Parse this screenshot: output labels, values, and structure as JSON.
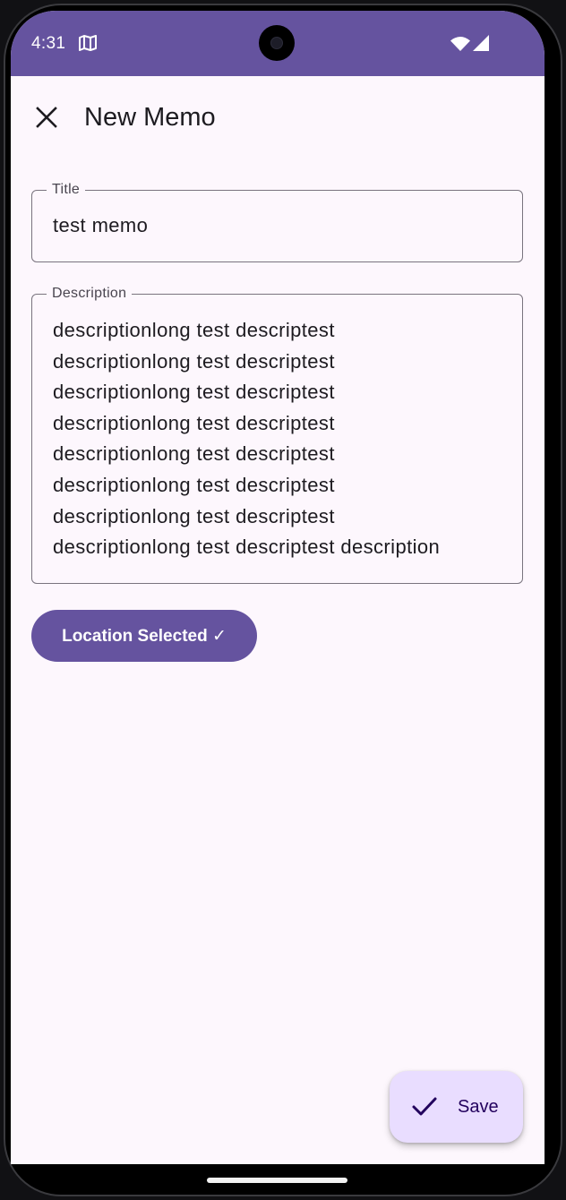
{
  "status_bar": {
    "time": "4:31",
    "background": "#65539f",
    "icons": [
      "map-icon",
      "wifi-icon",
      "cell-signal-icon"
    ]
  },
  "top_app_bar": {
    "title": "New Memo",
    "close_icon": "close-icon"
  },
  "form": {
    "title_field": {
      "label": "Title",
      "value": "test memo"
    },
    "description_field": {
      "label": "Description",
      "lines": [
        "descriptionlong test descriptest",
        "descriptionlong test descriptest",
        "descriptionlong test descriptest",
        "descriptionlong test descriptest",
        "descriptionlong test descriptest",
        "descriptionlong test descriptest",
        "descriptionlong test descriptest",
        "descriptionlong test descriptest description"
      ]
    },
    "location_button": {
      "label": "Location Selected ✓"
    }
  },
  "fab": {
    "label": "Save",
    "icon": "check-icon",
    "background": "#e9ddff"
  },
  "colors": {
    "primary": "#65539f",
    "surface": "#fdf7fd",
    "outline": "#79747e",
    "on_surface": "#1d1b20"
  }
}
